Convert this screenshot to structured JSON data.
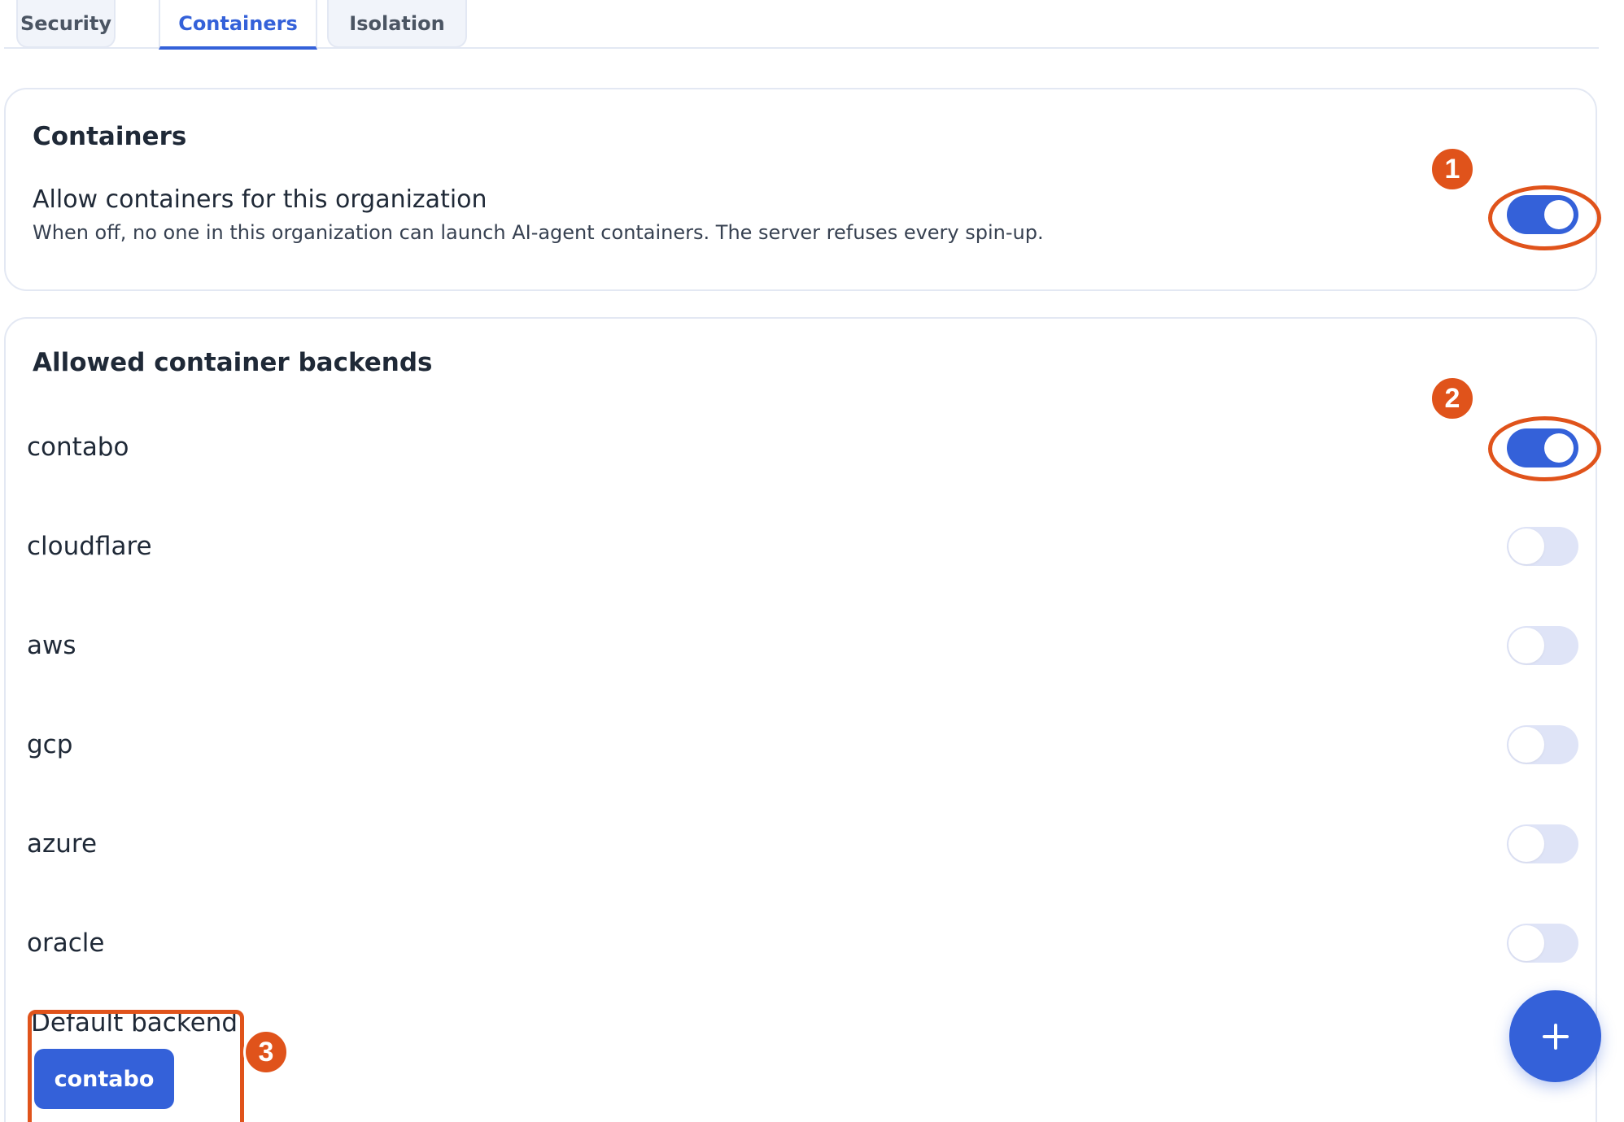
{
  "tabs": [
    {
      "label": "Security",
      "active": false
    },
    {
      "label": "Containers",
      "active": true
    },
    {
      "label": "Isolation",
      "active": false
    }
  ],
  "containers_card": {
    "title": "Containers",
    "setting_label": "Allow containers for this organization",
    "setting_description": "When off, no one in this organization can launch AI-agent containers. The server refuses every spin-up.",
    "enabled": true
  },
  "backends_card": {
    "title": "Allowed container backends",
    "backends": [
      {
        "name": "contabo",
        "enabled": true
      },
      {
        "name": "cloudflare",
        "enabled": false
      },
      {
        "name": "aws",
        "enabled": false
      },
      {
        "name": "gcp",
        "enabled": false
      },
      {
        "name": "azure",
        "enabled": false
      },
      {
        "name": "oracle",
        "enabled": false
      }
    ],
    "default_label": "Default backend",
    "default_value": "contabo"
  },
  "fab": {
    "icon": "plus-icon"
  },
  "annotations": [
    "1",
    "2",
    "3"
  ],
  "colors": {
    "accent": "#3461d9",
    "annotation": "#e0531b",
    "toggle_off": "#dfe4f7"
  }
}
